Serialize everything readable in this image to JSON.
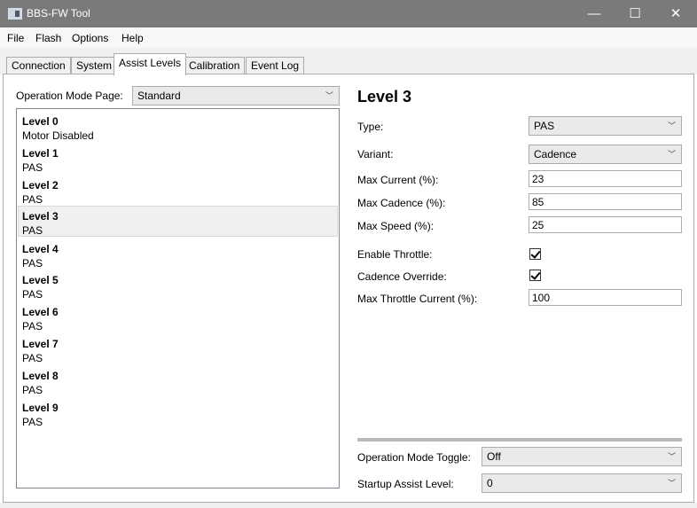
{
  "window": {
    "title": "BBS-FW Tool",
    "minimize": "—",
    "maximize": "☐",
    "close": "✕"
  },
  "menu": [
    "File",
    "Flash",
    "Options",
    "Help"
  ],
  "tabs": [
    "Connection",
    "System",
    "Assist Levels",
    "Calibration",
    "Event Log"
  ],
  "active_tab": "Assist Levels",
  "left": {
    "mode_page_label": "Operation Mode Page:",
    "mode_page_value": "Standard",
    "levels": [
      {
        "name": "Level  0",
        "type": "Motor Disabled"
      },
      {
        "name": "Level  1",
        "type": "PAS"
      },
      {
        "name": "Level  2",
        "type": "PAS"
      },
      {
        "name": "Level  3",
        "type": "PAS"
      },
      {
        "name": "Level  4",
        "type": "PAS"
      },
      {
        "name": "Level  5",
        "type": "PAS"
      },
      {
        "name": "Level  6",
        "type": "PAS"
      },
      {
        "name": "Level  7",
        "type": "PAS"
      },
      {
        "name": "Level  8",
        "type": "PAS"
      },
      {
        "name": "Level  9",
        "type": "PAS"
      }
    ],
    "selected_level": "Level  3"
  },
  "detail": {
    "heading": "Level  3",
    "type_label": "Type:",
    "type_value": "PAS",
    "variant_label": "Variant:",
    "variant_value": "Cadence",
    "max_current_label": "Max Current (%):",
    "max_current_value": "23",
    "max_cadence_label": "Max Cadence (%):",
    "max_cadence_value": "85",
    "max_speed_label": "Max Speed (%):",
    "max_speed_value": "25",
    "enable_throttle_label": "Enable Throttle:",
    "enable_throttle_checked": true,
    "cadence_override_label": "Cadence Override:",
    "cadence_override_checked": true,
    "max_throttle_label": "Max Throttle Current (%):",
    "max_throttle_value": "100"
  },
  "footer": {
    "mode_toggle_label": "Operation Mode Toggle:",
    "mode_toggle_value": "Off",
    "startup_label": "Startup Assist Level:",
    "startup_value": "0"
  }
}
